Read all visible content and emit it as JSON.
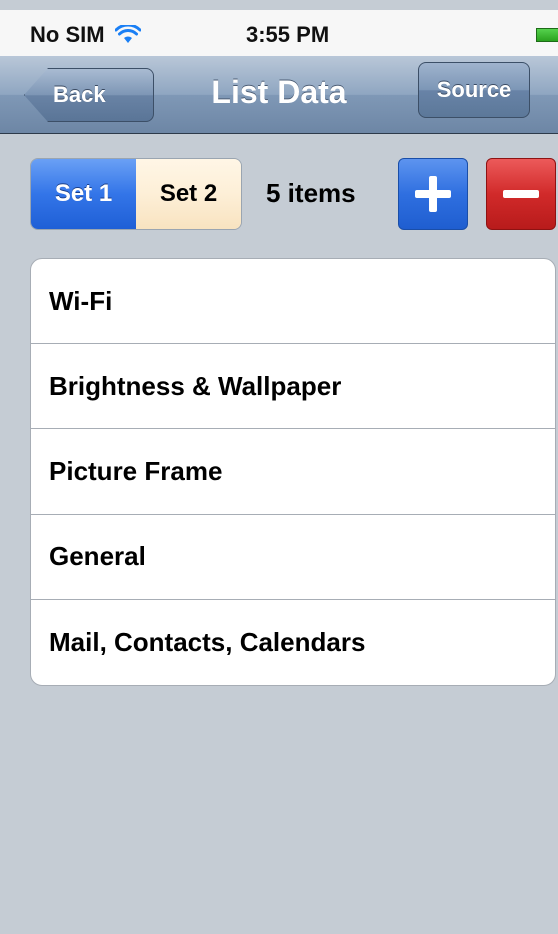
{
  "status_bar": {
    "carrier": "No SIM",
    "time": "3:55 PM"
  },
  "nav": {
    "back_label": "Back",
    "title": "List Data",
    "source_label": "Source"
  },
  "segments": [
    {
      "label": "Set 1",
      "selected": true
    },
    {
      "label": "Set 2",
      "selected": false
    }
  ],
  "item_count": "5 items",
  "buttons": {
    "add_icon": "plus-icon",
    "remove_icon": "minus-icon"
  },
  "list": {
    "items": [
      {
        "label": "Wi-Fi"
      },
      {
        "label": "Brightness & Wallpaper"
      },
      {
        "label": "Picture Frame"
      },
      {
        "label": "General"
      },
      {
        "label": "Mail, Contacts, Calendars"
      }
    ]
  },
  "colors": {
    "background": "#c5ccd4",
    "nav_bar": "#7f98b6",
    "selected_segment": "#3375e8",
    "add_button": "#2f6fe0",
    "remove_button": "#d12a2a"
  }
}
